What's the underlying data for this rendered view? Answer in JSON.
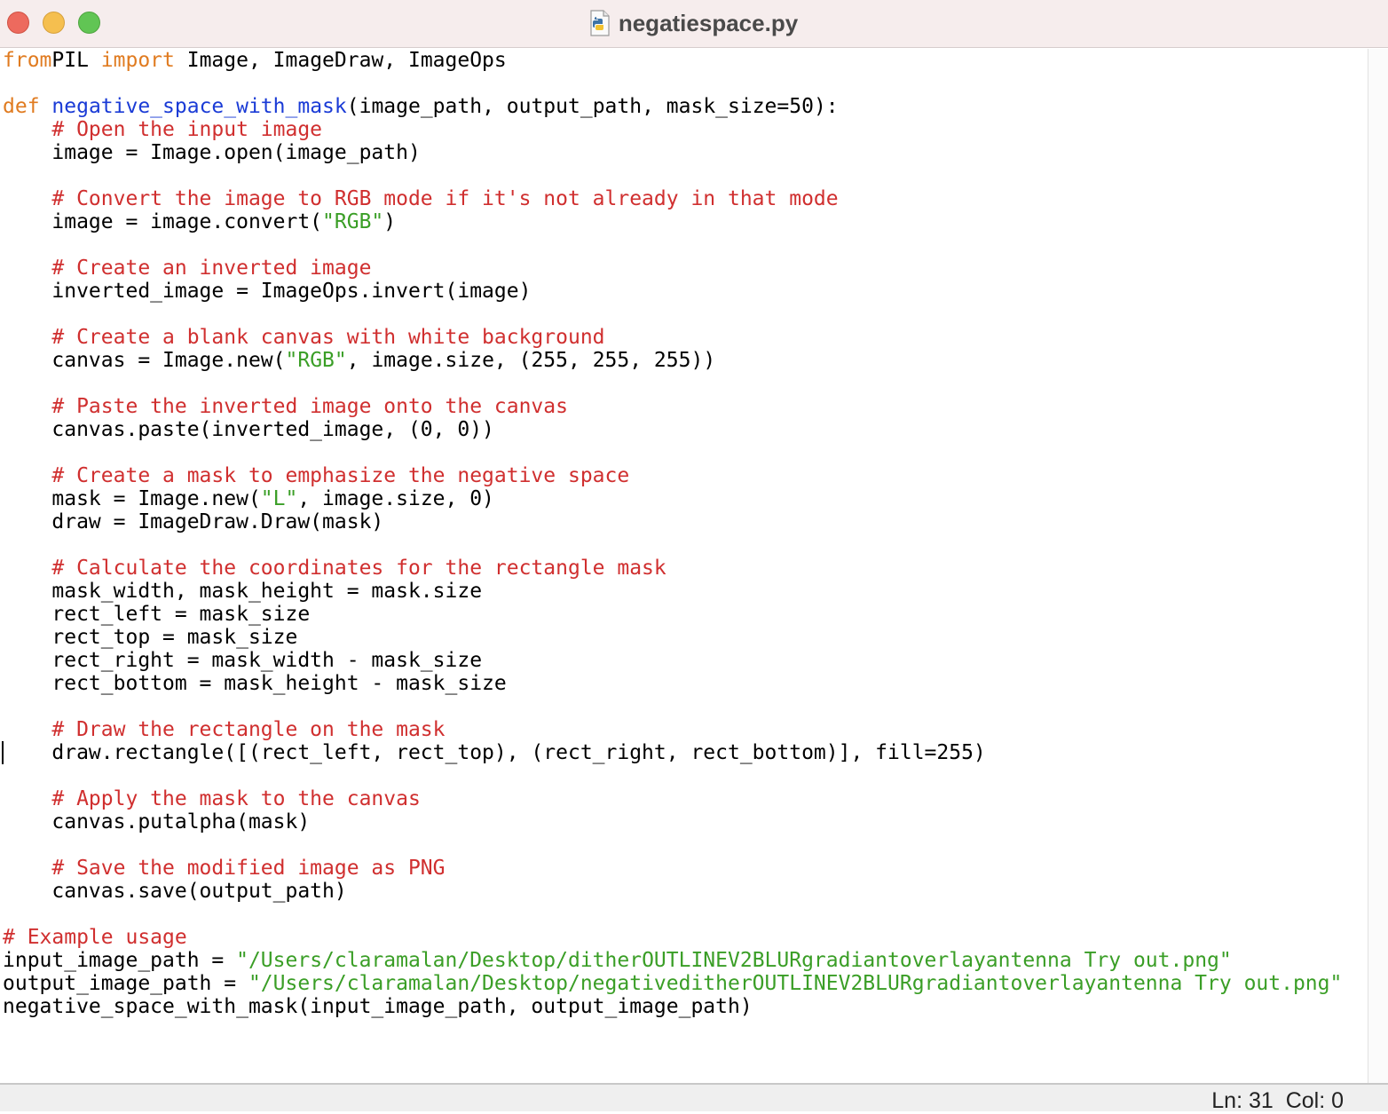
{
  "window": {
    "title": "negatiespace.py",
    "file_icon": "python-file-icon"
  },
  "editor": {
    "lines": [
      [
        [
          "kw",
          "from"
        ],
        [
          "",
          "PIL "
        ],
        [
          "kw",
          "import"
        ],
        [
          "",
          " Image, ImageDraw, ImageOps"
        ]
      ],
      [],
      [
        [
          "kw",
          "def"
        ],
        [
          "",
          " "
        ],
        [
          "fn",
          "negative_space_with_mask"
        ],
        [
          "",
          "(image_path, output_path, mask_size=50):"
        ]
      ],
      [
        [
          "",
          "    "
        ],
        [
          "cm",
          "# Open the input image"
        ]
      ],
      [
        [
          "",
          "    image = Image.open(image_path)"
        ]
      ],
      [],
      [
        [
          "",
          "    "
        ],
        [
          "cm",
          "# Convert the image to RGB mode if it's not already in that mode"
        ]
      ],
      [
        [
          "",
          "    image = image.convert("
        ],
        [
          "st",
          "\"RGB\""
        ],
        [
          "",
          ")"
        ]
      ],
      [],
      [
        [
          "",
          "    "
        ],
        [
          "cm",
          "# Create an inverted image"
        ]
      ],
      [
        [
          "",
          "    inverted_image = ImageOps.invert(image)"
        ]
      ],
      [],
      [
        [
          "",
          "    "
        ],
        [
          "cm",
          "# Create a blank canvas with white background"
        ]
      ],
      [
        [
          "",
          "    canvas = Image.new("
        ],
        [
          "st",
          "\"RGB\""
        ],
        [
          "",
          ", image.size, (255, 255, 255))"
        ]
      ],
      [],
      [
        [
          "",
          "    "
        ],
        [
          "cm",
          "# Paste the inverted image onto the canvas"
        ]
      ],
      [
        [
          "",
          "    canvas.paste(inverted_image, (0, 0))"
        ]
      ],
      [],
      [
        [
          "",
          "    "
        ],
        [
          "cm",
          "# Create a mask to emphasize the negative space"
        ]
      ],
      [
        [
          "",
          "    mask = Image.new("
        ],
        [
          "st",
          "\"L\""
        ],
        [
          "",
          ", image.size, 0)"
        ]
      ],
      [
        [
          "",
          "    draw = ImageDraw.Draw(mask)"
        ]
      ],
      [],
      [
        [
          "",
          "    "
        ],
        [
          "cm",
          "# Calculate the coordinates for the rectangle mask"
        ]
      ],
      [
        [
          "",
          "    mask_width, mask_height = mask.size"
        ]
      ],
      [
        [
          "",
          "    rect_left = mask_size"
        ]
      ],
      [
        [
          "",
          "    rect_top = mask_size"
        ]
      ],
      [
        [
          "",
          "    rect_right = mask_width - mask_size"
        ]
      ],
      [
        [
          "",
          "    rect_bottom = mask_height - mask_size"
        ]
      ],
      [],
      [
        [
          "",
          "    "
        ],
        [
          "cm",
          "# Draw the rectangle on the mask"
        ]
      ],
      [
        [
          "",
          "    draw.rectangle([(rect_left, rect_top), (rect_right, rect_bottom)], fill=255)"
        ]
      ],
      [],
      [
        [
          "",
          "    "
        ],
        [
          "cm",
          "# Apply the mask to the canvas"
        ]
      ],
      [
        [
          "",
          "    canvas.putalpha(mask)"
        ]
      ],
      [],
      [
        [
          "",
          "    "
        ],
        [
          "cm",
          "# Save the modified image as PNG"
        ]
      ],
      [
        [
          "",
          "    canvas.save(output_path)"
        ]
      ],
      [],
      [
        [
          "cm",
          "# Example usage"
        ]
      ],
      [
        [
          "",
          "input_image_path = "
        ],
        [
          "st",
          "\"/Users/claramalan/Desktop/ditherOUTLINEV2BLURgradiantoverlayantenna Try out.png\""
        ]
      ],
      [
        [
          "",
          "output_image_path = "
        ],
        [
          "st",
          "\"/Users/claramalan/Desktop/negativeditherOUTLINEV2BLURgradiantoverlayantenna Try out.png\""
        ]
      ],
      [
        [
          "",
          "negative_space_with_mask(input_image_path, output_image_path)"
        ]
      ]
    ]
  },
  "status": {
    "line_label": "Ln: 31",
    "col_label": "Col: 0"
  },
  "colors": {
    "keyword": "#e07b20",
    "function_name": "#1a3bd6",
    "comment": "#d02f2f",
    "string": "#3a9e26",
    "titlebar": "#f6eded"
  }
}
